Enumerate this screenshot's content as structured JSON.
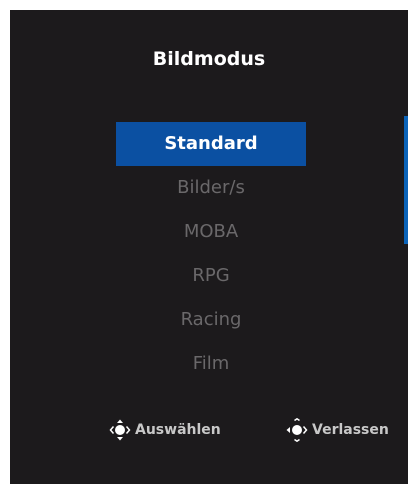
{
  "osd": {
    "title": "Bildmodus",
    "menu_items": [
      {
        "label": "Standard",
        "selected": true
      },
      {
        "label": "Bilder/s",
        "selected": false
      },
      {
        "label": "MOBA",
        "selected": false
      },
      {
        "label": "RPG",
        "selected": false
      },
      {
        "label": "Racing",
        "selected": false
      },
      {
        "label": "Film",
        "selected": false
      }
    ],
    "hints": {
      "select_label": "Auswählen",
      "select_icon": "joystick-updown-icon",
      "exit_label": "Verlassen",
      "exit_icon": "joystick-left-icon"
    }
  },
  "colors": {
    "background": "#1c1a1c",
    "selected_bg": "#0b50a2",
    "scrollbar": "#0b63b8",
    "inactive_text": "#6a686a"
  }
}
